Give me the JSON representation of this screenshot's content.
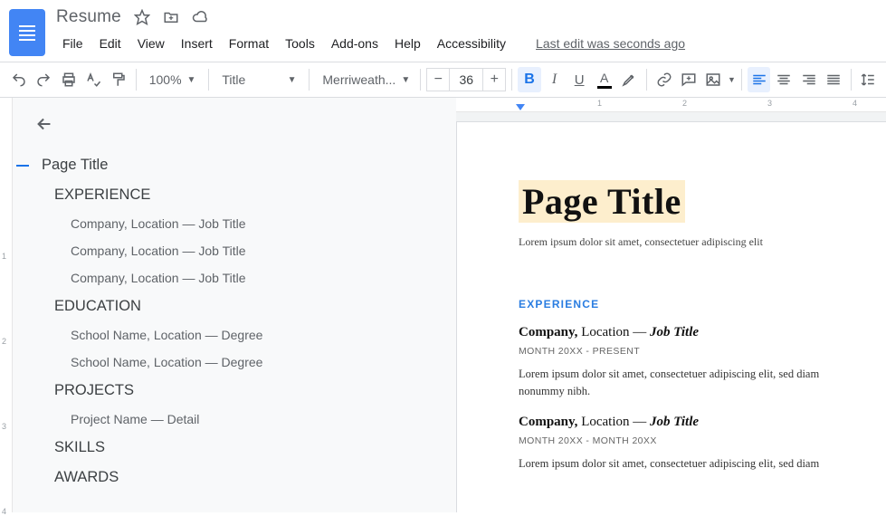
{
  "header": {
    "doc_title": "Resume",
    "menus": [
      "File",
      "Edit",
      "View",
      "Insert",
      "Format",
      "Tools",
      "Add-ons",
      "Help",
      "Accessibility"
    ],
    "last_edit": "Last edit was seconds ago"
  },
  "toolbar": {
    "zoom": "100%",
    "style": "Title",
    "font": "Merriweath...",
    "font_size": "36"
  },
  "outline": {
    "items": [
      {
        "level": 0,
        "label": "Page Title",
        "current": true
      },
      {
        "level": 0,
        "label": "EXPERIENCE"
      },
      {
        "level": 1,
        "label": "Company, Location — Job Title"
      },
      {
        "level": 1,
        "label": "Company, Location — Job Title"
      },
      {
        "level": 1,
        "label": "Company, Location — Job Title"
      },
      {
        "level": 0,
        "label": "EDUCATION"
      },
      {
        "level": 1,
        "label": "School Name, Location — Degree"
      },
      {
        "level": 1,
        "label": "School Name, Location — Degree"
      },
      {
        "level": 0,
        "label": "PROJECTS"
      },
      {
        "level": 1,
        "label": "Project Name — Detail"
      },
      {
        "level": 0,
        "label": "SKILLS"
      },
      {
        "level": 0,
        "label": "AWARDS"
      }
    ]
  },
  "ruler": {
    "h": [
      "1",
      "2",
      "3",
      "4"
    ],
    "v": [
      "1",
      "2",
      "3",
      "4"
    ]
  },
  "page": {
    "title": "Page Title",
    "subtitle": "Lorem ipsum dolor sit amet, consectetuer adipiscing elit",
    "sections": [
      {
        "heading": "EXPERIENCE",
        "jobs": [
          {
            "company": "Company,",
            "location": "Location —",
            "title": "Job Title",
            "dates": "MONTH 20XX - PRESENT",
            "body": "Lorem ipsum dolor sit amet, consectetuer adipiscing elit, sed diam nonummy nibh."
          },
          {
            "company": "Company,",
            "location": "Location —",
            "title": "Job Title",
            "dates": "MONTH 20XX - MONTH 20XX",
            "body": "Lorem ipsum dolor sit amet, consectetuer adipiscing elit, sed diam"
          }
        ]
      }
    ]
  }
}
